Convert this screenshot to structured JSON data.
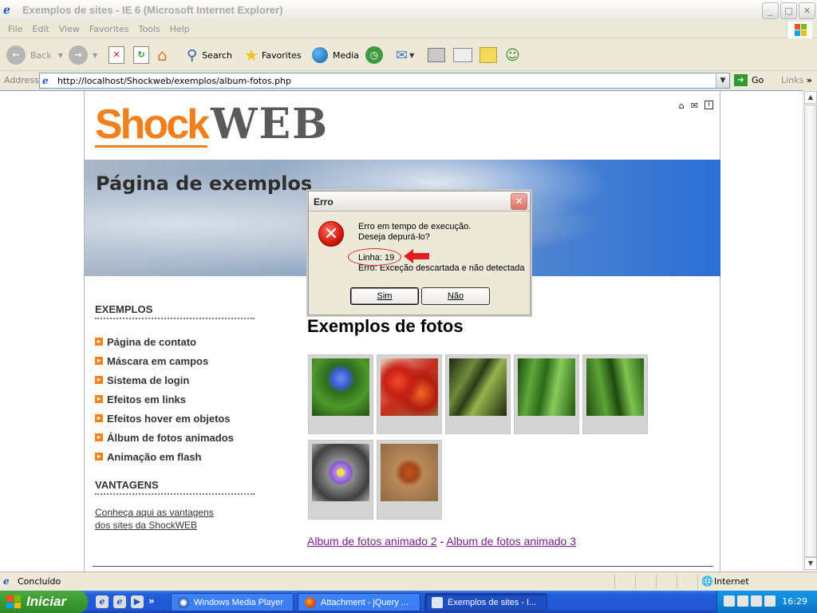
{
  "window": {
    "title": "Exemplos de sites - IE 6 (Microsoft Internet Explorer)",
    "controls": {
      "minimize": "_",
      "maximize": "□",
      "close": "✕"
    }
  },
  "menu": [
    "File",
    "Edit",
    "View",
    "Favorites",
    "Tools",
    "Help"
  ],
  "toolbar": {
    "back": "Back",
    "search": "Search",
    "favorites": "Favorites",
    "media": "Media"
  },
  "address": {
    "label": "Address",
    "url": "http://localhost/Shockweb/exemplos/album-fotos.php",
    "go": "Go",
    "links": "Links"
  },
  "site": {
    "logo_shock": "Shock",
    "logo_web": "WEB",
    "banner_title": "Página de exemplos",
    "sidebar": {
      "section1": "EXEMPLOS",
      "items": [
        "Página de contato",
        "Máscara em campos",
        "Sistema de login",
        "Efeitos em links",
        "Efeitos hover em objetos",
        "Álbum de fotos animados",
        "Animação em flash"
      ],
      "section2": "VANTAGENS",
      "vantagens_link_1": "Conheça aqui as vantagens",
      "vantagens_link_2": "dos sites da ShockWEB"
    },
    "main_heading": "Exemplos de fotos",
    "album_link_2": "Album de fotos animado 2",
    "album_sep": " - ",
    "album_link_3": "Album de fotos animado 3"
  },
  "dialog": {
    "title": "Erro",
    "line1": "Erro em tempo de execução.",
    "line2": "Deseja depurá-lo?",
    "line3": "Linha: 19",
    "line4": "Erro: Exceção descartada e não detectada",
    "yes": "Sim",
    "no": "Não"
  },
  "status": {
    "text": "Concluído",
    "zone": "Internet"
  },
  "taskbar": {
    "start": "Iniciar",
    "tasks": [
      "Windows Media Player",
      "Attachment - jQuery ...",
      "Exemplos de sites - I..."
    ],
    "clock": "16:29"
  },
  "colors": {
    "brand_orange": "#f07f1c",
    "brand_gray": "#5a5a5a",
    "link_purple": "#7a1f8c",
    "annotation_red": "#e02020"
  }
}
